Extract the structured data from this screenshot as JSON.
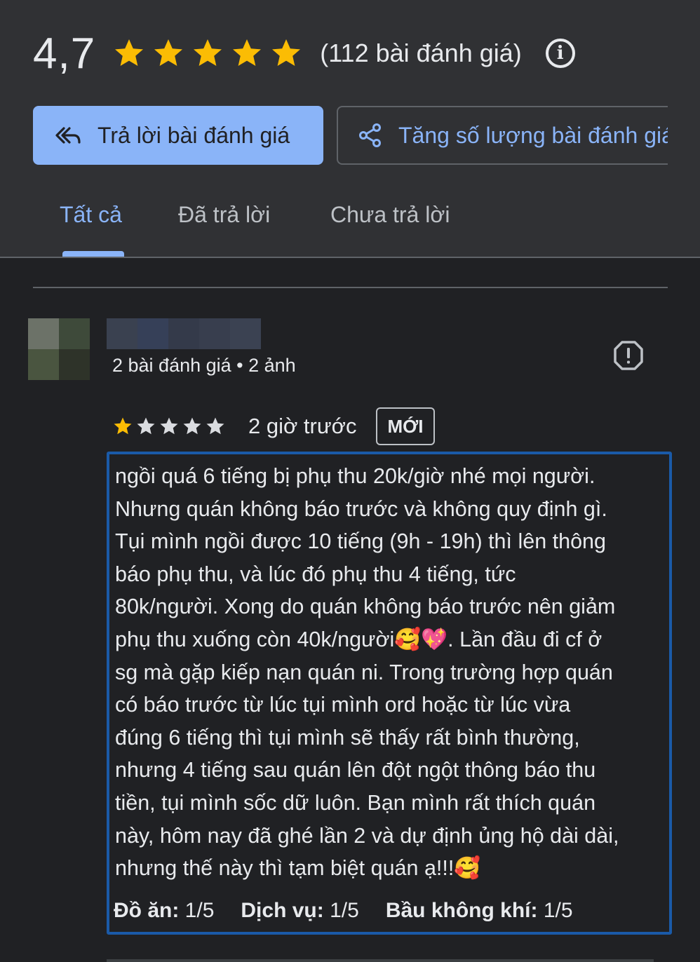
{
  "summary": {
    "rating": "4,7",
    "stars_filled": 5,
    "review_count": "(112 bài đánh giá)",
    "info_icon": "info-icon"
  },
  "actions": {
    "reply_label": "Trả lời bài đánh giá",
    "share_label": "Tăng số lượng bài đánh giá"
  },
  "tabs": [
    {
      "label": "Tất cả",
      "active": true
    },
    {
      "label": "Đã trả lời",
      "active": false
    },
    {
      "label": "Chưa trả lời",
      "active": false
    }
  ],
  "review": {
    "reviewer_meta": "2 bài đánh giá • 2 ảnh",
    "rating_stars": 1,
    "rating_max": 5,
    "time_ago": "2 giờ trước",
    "badge": "MỚI",
    "text": "ngồi quá 6 tiếng bị phụ thu 20k/giờ nhé mọi người.\nNhưng quán không báo trước và không quy định gì.\nTụi mình ngồi được 10 tiếng (9h - 19h) thì lên thông\nbáo phụ thu, và lúc đó phụ thu 4 tiếng, tức\n80k/người. Xong do quán không báo trước nên giảm\nphụ thu xuống còn 40k/người🥰💖. Lần đầu đi cf ở\nsg mà gặp kiếp nạn quán ni. Trong trường hợp quán\ncó báo trước từ lúc tụi mình ord hoặc từ lúc vừa\nđúng 6 tiếng thì tụi mình sẽ thấy rất bình thường,\nnhưng 4 tiếng sau quán lên đột ngột thông báo thu\ntiền, tụi mình sốc dữ luôn. Bạn mình rất thích quán\nnày, hôm nay đã ghé lần 2 và dự định ủng hộ dài dài,\nnhưng thế này thì tạm biệt quán ạ!!!🥰",
    "aspects": [
      {
        "label": "Đồ ăn:",
        "value": "1/5"
      },
      {
        "label": "Dịch vụ:",
        "value": "1/5"
      },
      {
        "label": "Bầu không khí:",
        "value": "1/5"
      }
    ]
  },
  "colors": {
    "accent": "#8ab4f8",
    "star": "#fbbc04",
    "highlight_border": "#1a5aa8"
  }
}
